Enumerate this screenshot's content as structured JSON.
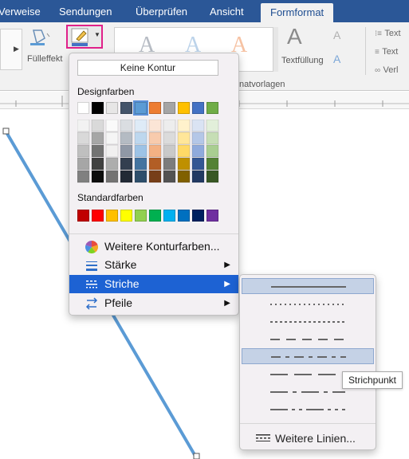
{
  "tabs": [
    {
      "label": "Verweise"
    },
    {
      "label": "Sendungen"
    },
    {
      "label": "Überprüfen"
    },
    {
      "label": "Ansicht"
    },
    {
      "label": "Formformat"
    }
  ],
  "ribbon": {
    "fill_label": "Fülleffekt",
    "textfill_label": "Textfüllung",
    "styles_group_label": "natvorlagen",
    "right_items": [
      "Text",
      "Text",
      "Verl"
    ]
  },
  "menu": {
    "no_outline": "Keine Kontur",
    "theme_colors_label": "Designfarben",
    "standard_colors_label": "Standardfarben",
    "more_colors": "Weitere Konturfarben...",
    "weight": "Stärke",
    "dashes": "Striche",
    "arrows": "Pfeile"
  },
  "theme_top": [
    "#ffffff",
    "#000000",
    "#e7e6e6",
    "#44546a",
    "#5b9bd5",
    "#ed7d31",
    "#a5a5a5",
    "#ffc000",
    "#4472c4",
    "#70ad47"
  ],
  "standard_colors": [
    "#c00000",
    "#ff0000",
    "#ffc000",
    "#ffff00",
    "#92d050",
    "#00b050",
    "#00b0f0",
    "#0070c0",
    "#002060",
    "#7030a0"
  ],
  "submenu": {
    "more_lines": "Weitere Linien..."
  },
  "tooltip": "Strichpunkt",
  "colors": {
    "ribbon_tab_bg": "#2b5797",
    "highlight": "#1d62d3",
    "selected_dash_bg": "#c5d2e6",
    "line_blue": "#5b9bd5",
    "active_button_border": "#e0218a"
  }
}
